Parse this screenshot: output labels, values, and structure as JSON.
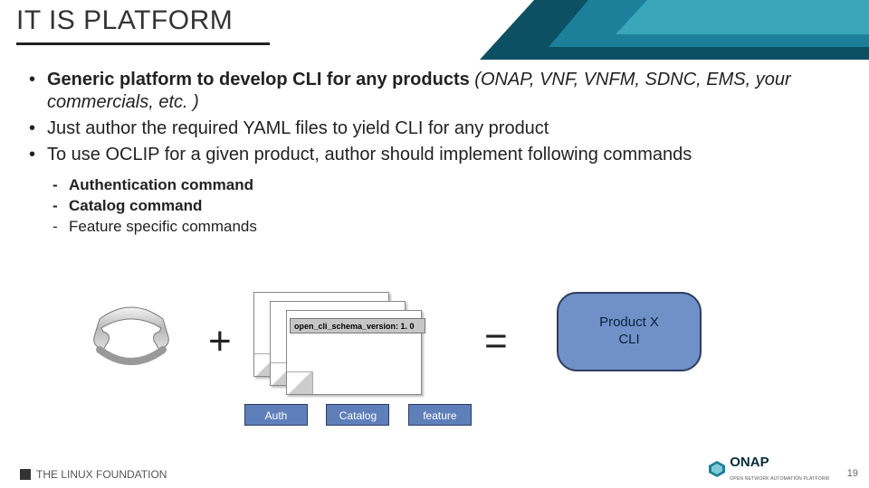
{
  "title": "IT IS PLATFORM",
  "bullets": {
    "b1_bold": "Generic platform to develop CLI for any products",
    "b1_ital": " (ONAP, VNF, VNFM, SDNC, EMS, your commercials, etc. )",
    "b2": "Just author the required YAML files to yield CLI for any product",
    "b3": "To use OCLIP for a  given product, author should implement following commands"
  },
  "sub": {
    "s1": "Authentication command",
    "s2": "Catalog command",
    "s3": "Feature specific commands"
  },
  "diagram": {
    "plus": "+",
    "equals": "=",
    "schema_label": "open_cli_schema_version: 1. 0",
    "tag_auth": "Auth",
    "tag_catalog": "Catalog",
    "tag_feature": "feature",
    "product_line1": "Product X",
    "product_line2": "CLI"
  },
  "footer": {
    "linux": "THE LINUX FOUNDATION",
    "onap": "ONAP",
    "onap_sub": "OPEN NETWORK AUTOMATION PLATFORM",
    "page": "19"
  }
}
